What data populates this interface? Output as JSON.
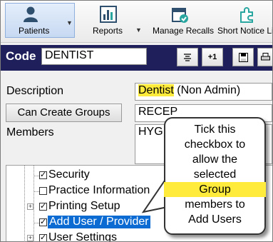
{
  "toolbar": {
    "items": [
      {
        "label": "Patients",
        "icon": "person-icon",
        "selected": true
      },
      {
        "label": "Reports",
        "icon": "bar-chart-icon"
      },
      {
        "label": "Manage Recalls",
        "icon": "calendar-check-icon"
      },
      {
        "label": "Short Notice Li",
        "icon": "puzzle-icon"
      }
    ]
  },
  "header": {
    "code_label": "Code",
    "code_value": "DENTIST",
    "button_plus_one": "+1"
  },
  "form": {
    "description_label": "Description",
    "description_highlight": "Dentist",
    "description_rest": " (Non Admin)",
    "can_create_groups_button": "Can Create Groups",
    "can_create_groups_value": "RECEP",
    "members_label": "Members",
    "members_value": "HYG"
  },
  "tree": {
    "items": [
      {
        "label": "Security",
        "checked": true
      },
      {
        "label": "Practice Information",
        "checked": false
      },
      {
        "label": "Printing Setup",
        "checked": true,
        "expandable": true
      },
      {
        "label": "Add User / Provider",
        "checked": true,
        "selected": true
      },
      {
        "label": "User Settings",
        "checked": true,
        "expandable": true
      }
    ]
  },
  "callout": {
    "lines": [
      "Tick this",
      "checkbox to",
      "allow the",
      "selected"
    ],
    "highlight": "Group",
    "lines_after": [
      "members  to",
      "Add Users"
    ],
    "highlight_color": "#ffeb3b"
  },
  "colors": {
    "header_bg": "#1f1f5c",
    "selection": "#0b6bd3"
  }
}
